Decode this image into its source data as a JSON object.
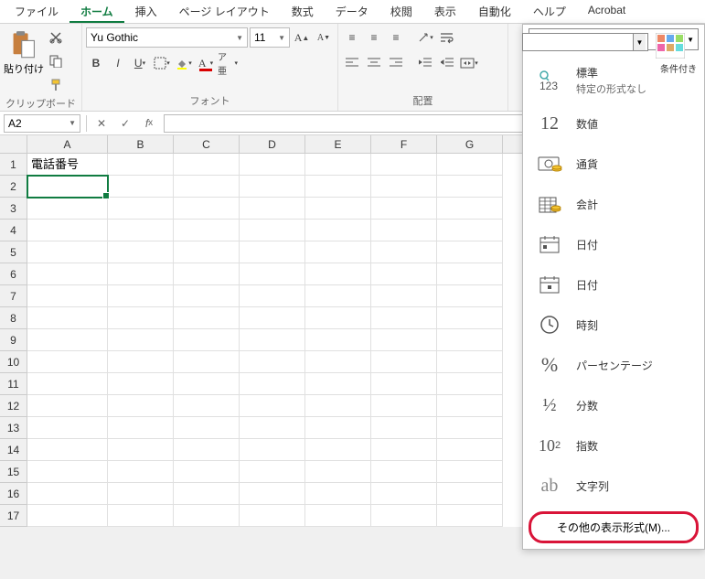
{
  "tabs": {
    "file": "ファイル",
    "home": "ホーム",
    "insert": "挿入",
    "layout": "ページ レイアウト",
    "formula": "数式",
    "data": "データ",
    "review": "校閲",
    "view": "表示",
    "automate": "自動化",
    "help": "ヘルプ",
    "acrobat": "Acrobat"
  },
  "ribbon": {
    "clipboard": {
      "label": "クリップボード",
      "paste": "貼り付け"
    },
    "font": {
      "label": "フォント",
      "name": "Yu Gothic",
      "size": "11"
    },
    "align": {
      "label": "配置"
    },
    "condfmt": "条件付き"
  },
  "namebox": "A2",
  "sheet": {
    "cols": [
      "A",
      "B",
      "C",
      "D",
      "E",
      "F",
      "G"
    ],
    "rows": [
      1,
      2,
      3,
      4,
      5,
      6,
      7,
      8,
      9,
      10,
      11,
      12,
      13,
      14,
      15,
      16,
      17
    ],
    "a1": "電話番号"
  },
  "formats": {
    "general": {
      "t": "標準",
      "s": "特定の形式なし"
    },
    "number": {
      "t": "数値"
    },
    "currency": {
      "t": "通貨"
    },
    "accounting": {
      "t": "会計"
    },
    "date1": {
      "t": "日付"
    },
    "date2": {
      "t": "日付"
    },
    "time": {
      "t": "時刻"
    },
    "percent": {
      "t": "パーセンテージ"
    },
    "fraction": {
      "t": "分数"
    },
    "scientific": {
      "t": "指数"
    },
    "text": {
      "t": "文字列"
    },
    "more": "その他の表示形式(M)..."
  }
}
